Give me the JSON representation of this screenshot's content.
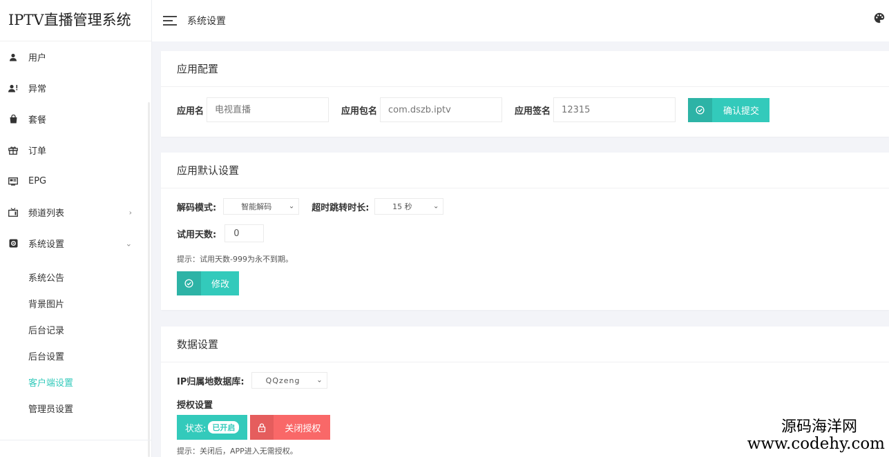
{
  "app": {
    "title": "IPTV直播管理系统"
  },
  "header": {
    "title": "系统设置"
  },
  "sidebar": {
    "items": [
      {
        "label": "用户",
        "icon": "user-icon"
      },
      {
        "label": "异常",
        "icon": "user-alert-icon"
      },
      {
        "label": "套餐",
        "icon": "bag-icon"
      },
      {
        "label": "订单",
        "icon": "gift-icon"
      },
      {
        "label": "EPG",
        "icon": "epg-icon"
      },
      {
        "label": "频道列表",
        "icon": "tv-icon",
        "arrow": "›"
      },
      {
        "label": "系统设置",
        "icon": "settings-icon",
        "arrow": "⌄"
      }
    ],
    "sub_items": [
      {
        "label": "系统公告"
      },
      {
        "label": "背景图片"
      },
      {
        "label": "后台记录"
      },
      {
        "label": "后台设置"
      },
      {
        "label": "客户端设置",
        "active": true
      },
      {
        "label": "管理员设置"
      }
    ]
  },
  "app_config": {
    "title": "应用配置",
    "name_label": "应用名",
    "name_placeholder": "电视直播",
    "package_label": "应用包名",
    "package_placeholder": "com.dszb.iptv",
    "sign_label": "应用签名",
    "sign_placeholder": "12315",
    "submit_label": "确认提交"
  },
  "default_settings": {
    "title": "应用默认设置",
    "decode_label": "解码模式:",
    "decode_value": "智能解码",
    "timeout_label": "超时跳转时长:",
    "timeout_value": "15 秒",
    "trial_label": "试用天数:",
    "trial_value": "0",
    "tip": "提示：试用天数-999为永不到期。",
    "modify_label": "修改"
  },
  "data_settings": {
    "title": "数据设置",
    "ipdb_label": "IP归属地数据库:",
    "ipdb_value": "QQzeng",
    "auth_title": "授权设置",
    "status_label": "状态:",
    "status_badge": "已开启",
    "close_auth_label": "关闭授权",
    "tip": "提示：关闭后，APP进入无需授权。"
  },
  "watermark": {
    "line1": "源码海洋网",
    "line2": "www.codehy.com"
  },
  "colors": {
    "accent": "#33cabb",
    "danger": "#f96868",
    "background": "#f3f4f8"
  }
}
